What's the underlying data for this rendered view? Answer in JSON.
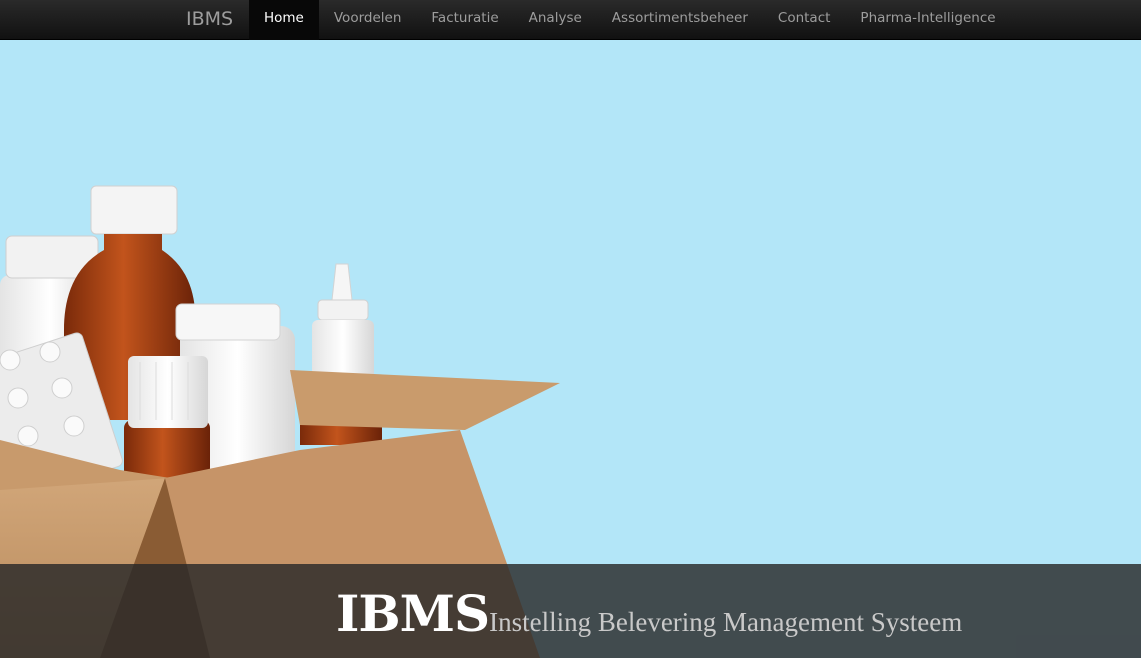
{
  "navbar": {
    "brand": "IBMS",
    "items": [
      {
        "label": "Home",
        "active": true
      },
      {
        "label": "Voordelen",
        "active": false
      },
      {
        "label": "Facturatie",
        "active": false
      },
      {
        "label": "Analyse",
        "active": false
      },
      {
        "label": "Assortimentsbeheer",
        "active": false
      },
      {
        "label": "Contact",
        "active": false
      },
      {
        "label": "Pharma-Intelligence",
        "active": false
      }
    ]
  },
  "hero": {
    "image": "medicine-box-photo",
    "background_color": "#b3e6f8"
  },
  "caption": {
    "title": "IBMS",
    "subtitle": "Instelling Belevering Management Systeem"
  }
}
